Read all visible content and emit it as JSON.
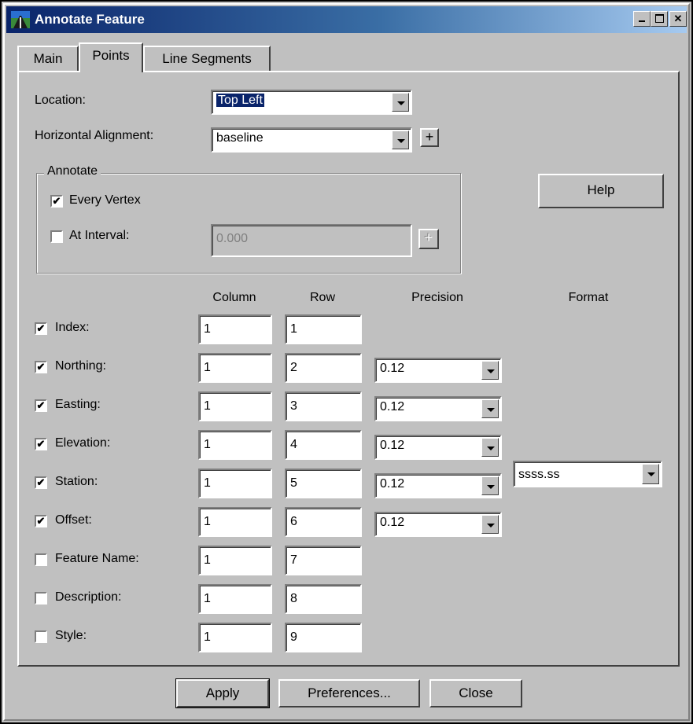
{
  "window": {
    "title": "Annotate Feature"
  },
  "tabs": [
    {
      "label": "Main"
    },
    {
      "label": "Points"
    },
    {
      "label": "Line Segments"
    }
  ],
  "location": {
    "label": "Location:",
    "value": "Top Left"
  },
  "horizontal_alignment": {
    "label": "Horizontal Alignment:",
    "value": "baseline"
  },
  "annotate": {
    "title": "Annotate",
    "every_vertex": {
      "label": "Every Vertex",
      "checked": true
    },
    "at_interval": {
      "label": "At Interval:",
      "checked": false,
      "value": "0.000"
    }
  },
  "help_label": "Help",
  "columns": {
    "column": "Column",
    "row": "Row",
    "precision": "Precision",
    "format": "Format"
  },
  "rows": [
    {
      "label": "Index:",
      "checked": true,
      "column": "1",
      "row": "1"
    },
    {
      "label": "Northing:",
      "checked": true,
      "column": "1",
      "row": "2",
      "precision": "0.12"
    },
    {
      "label": "Easting:",
      "checked": true,
      "column": "1",
      "row": "3",
      "precision": "0.12"
    },
    {
      "label": "Elevation:",
      "checked": true,
      "column": "1",
      "row": "4",
      "precision": "0.12"
    },
    {
      "label": "Station:",
      "checked": true,
      "column": "1",
      "row": "5",
      "precision": "0.12",
      "format": "ssss.ss"
    },
    {
      "label": "Offset:",
      "checked": true,
      "column": "1",
      "row": "6",
      "precision": "0.12"
    },
    {
      "label": "Feature Name:",
      "checked": false,
      "column": "1",
      "row": "7"
    },
    {
      "label": "Description:",
      "checked": false,
      "column": "1",
      "row": "8"
    },
    {
      "label": "Style:",
      "checked": false,
      "column": "1",
      "row": "9"
    }
  ],
  "footer": {
    "apply": "Apply",
    "preferences": "Preferences...",
    "close": "Close"
  },
  "checkmark": "✔",
  "plus": "+",
  "colors": {
    "title_start": "#0a246a",
    "title_end": "#a6caf0",
    "face": "#c0c0c0",
    "selection": "#0a246a"
  }
}
